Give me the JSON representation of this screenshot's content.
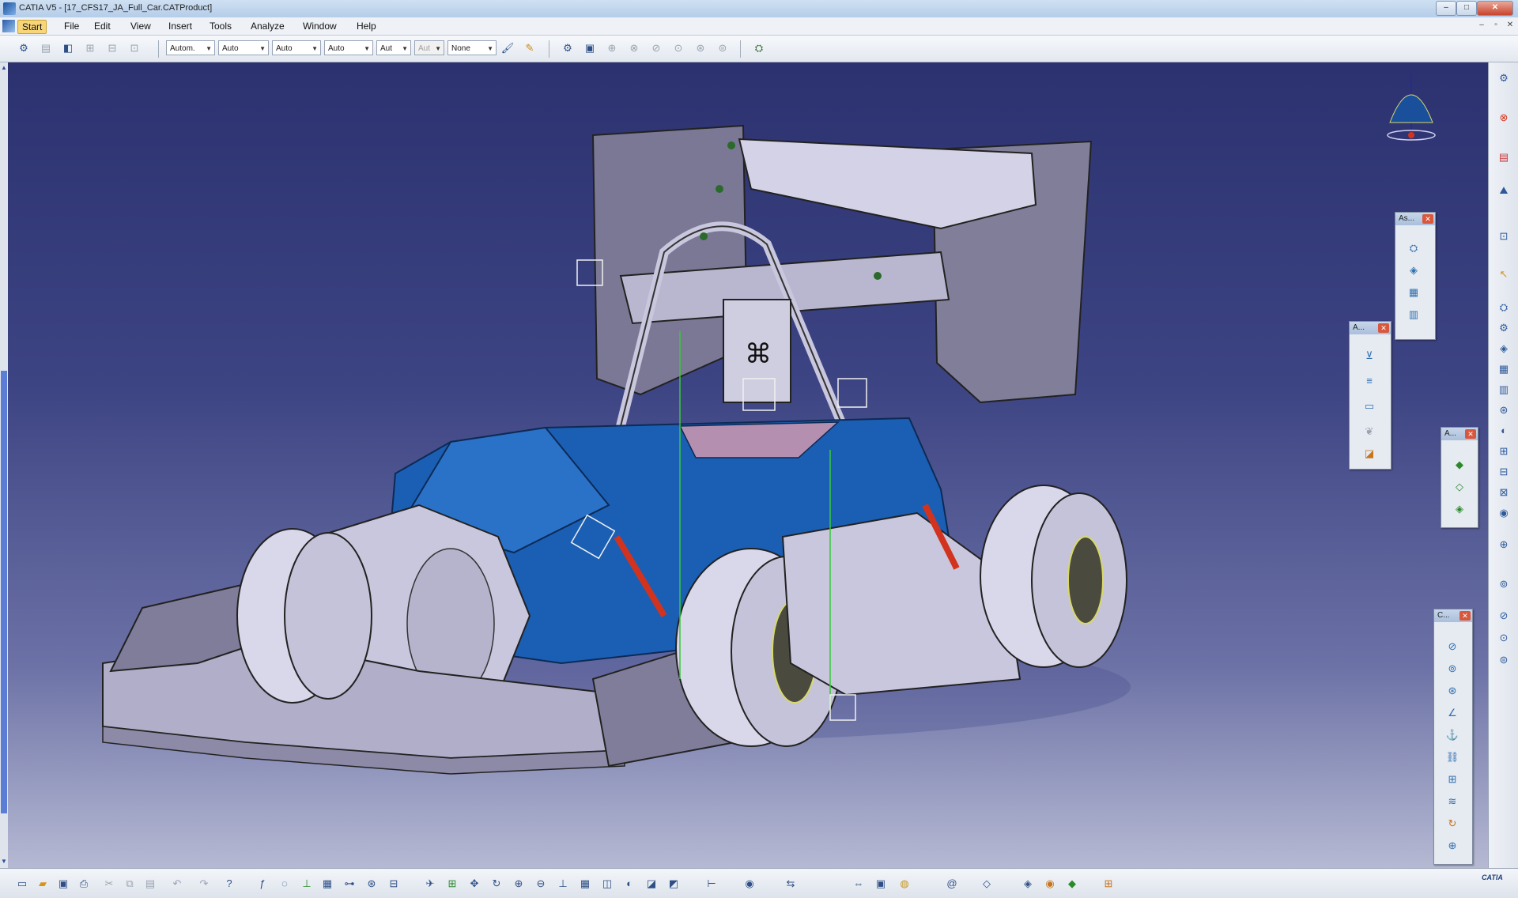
{
  "window": {
    "title": "CATIA V5 - [17_CFS17_JA_Full_Car.CATProduct]",
    "min_label": "–",
    "max_label": "□",
    "close_label": "✕"
  },
  "menu": {
    "items": [
      "Start",
      "File",
      "Edit",
      "View",
      "Insert",
      "Tools",
      "Analyze",
      "Window",
      "Help"
    ],
    "mdi_controls": [
      "–",
      "▫",
      "✕"
    ]
  },
  "toolbar_top": {
    "combos": [
      {
        "value": "Autom.",
        "enabled": true
      },
      {
        "value": "Auto",
        "enabled": true
      },
      {
        "value": "Auto",
        "enabled": true
      },
      {
        "value": "Auto",
        "enabled": true
      },
      {
        "value": "Aut",
        "enabled": true
      },
      {
        "value": "Aut",
        "enabled": false
      },
      {
        "value": "None",
        "enabled": true
      }
    ]
  },
  "floating_toolbars": [
    {
      "title": "As..."
    },
    {
      "title": "A..."
    },
    {
      "title": "A..."
    },
    {
      "title": "C..."
    }
  ],
  "brand": {
    "logo_text": "CATIA"
  },
  "colors": {
    "background_top": "#2c3270",
    "background_bottom": "#b6b9d3",
    "car_body": "#1a5fb4",
    "car_panels": "#c9c7dd",
    "menu_active": "#f7d67a",
    "close_red": "#c8442c"
  }
}
